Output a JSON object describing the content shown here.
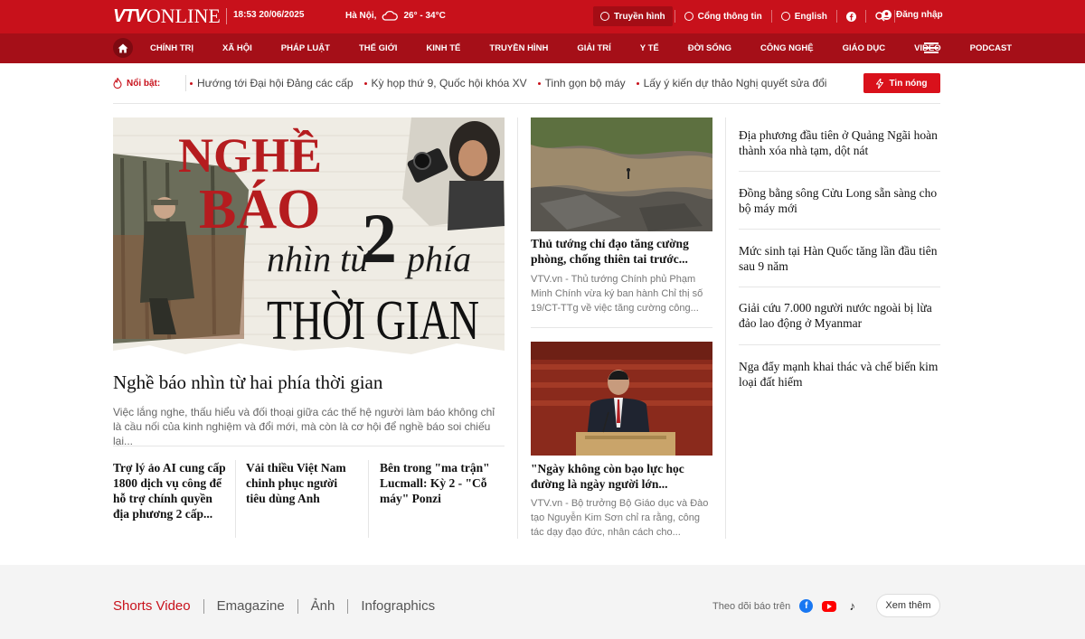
{
  "header": {
    "logo_vtv": "VTV",
    "logo_online": "ONLINE",
    "datetime": "18:53 20/06/2025",
    "weather": {
      "city": "Hà Nội,",
      "temp": "26° - 34°C"
    },
    "links": {
      "tv": "Truyền hình",
      "portal": "Cổng thông tin",
      "english": "English",
      "login": "Đăng nhập"
    }
  },
  "nav": {
    "items": [
      "CHÍNH TRỊ",
      "XÃ HỘI",
      "PHÁP LUẬT",
      "THẾ GIỚI",
      "KINH TẾ",
      "TRUYỀN HÌNH",
      "GIẢI TRÍ",
      "Y TẾ",
      "ĐỜI SỐNG",
      "CÔNG NGHỆ",
      "GIÁO DỤC",
      "VIDEO",
      "PODCAST"
    ]
  },
  "highlights": {
    "label": "Nổi bật:",
    "items": [
      "Hướng tới Đại hội Đảng các cấp",
      "Kỳ họp thứ 9, Quốc hội khóa XV",
      "Tinh gọn bộ máy",
      "Lấy ý kiến dự thảo Nghị quyết sửa đổi"
    ],
    "hot_button": "Tin nóng"
  },
  "feature": {
    "image_text": {
      "line1": "NGHỀ",
      "line2": "BÁO",
      "line3": "nhìn từ",
      "line3_num": "2",
      "line3_end": "phía",
      "line4": "THỜI GIAN"
    },
    "title": "Nghề báo nhìn từ hai phía thời gian",
    "summary": "Việc lắng nghe, thấu hiểu và đối thoại giữa các thế hệ người làm báo không chỉ là cầu nối của kinh nghiệm và đổi mới, mà còn là cơ hội để nghề báo soi chiếu lại..."
  },
  "sub_stories": [
    "Trợ lý ảo AI cung cấp 1800 dịch vụ công để hỗ trợ chính quyền địa phương 2 cấp...",
    "Vải thiều Việt Nam chinh phục người tiêu dùng Anh",
    "Bên trong \"ma trận\" Lucmall: Kỳ 2 - \"Cỗ máy\" Ponzi"
  ],
  "middle": [
    {
      "title": "Thủ tướng chỉ đạo tăng cường phòng, chống thiên tai trước...",
      "summary": "VTV.vn - Thủ tướng Chính phủ Phạm Minh Chính vừa ký ban hành Chỉ thị số 19/CT-TTg về việc tăng cường công..."
    },
    {
      "title": "\"Ngày không còn bạo lực học đường là ngày người lớn...",
      "summary": "VTV.vn - Bộ trưởng Bộ Giáo dục và Đào tạo Nguyễn Kim Sơn chỉ ra rằng, công tác dạy đạo đức, nhân cách cho..."
    }
  ],
  "right_list": [
    "Địa phương đầu tiên ở Quảng Ngãi hoàn thành xóa nhà tạm, dột nát",
    "Đồng bằng sông Cửu Long sẵn sàng cho bộ máy mới",
    "Mức sinh tại Hàn Quốc tăng lần đầu tiên sau 9 năm",
    "Giải cứu 7.000 người nước ngoài bị lừa đảo lao động ở Myanmar",
    "Nga đẩy mạnh khai thác và chế biến kim loại đất hiếm"
  ],
  "bottom": {
    "tabs": [
      "Shorts Video",
      "Emagazine",
      "Ảnh",
      "Infographics"
    ],
    "follow_label": "Theo dõi báo trên",
    "more": "Xem thêm"
  },
  "colors": {
    "brand_red": "#c8111b",
    "nav_red": "#a50f18"
  }
}
